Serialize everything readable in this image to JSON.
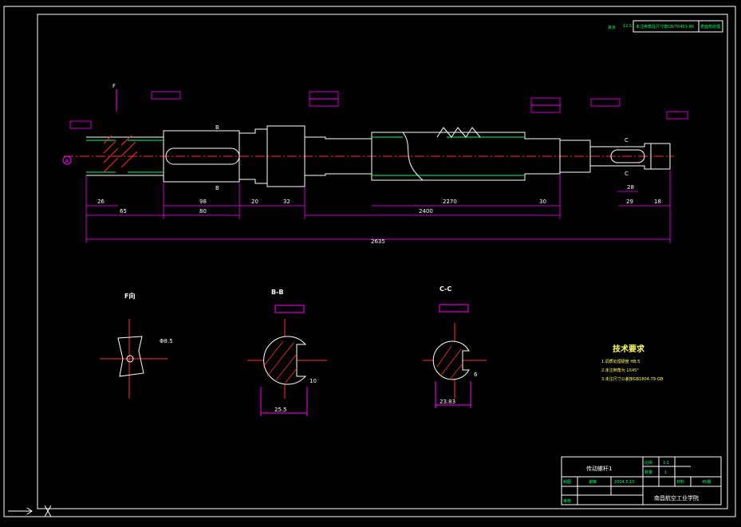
{
  "drawing": {
    "top_left_note": "F向",
    "corner_note": "其余",
    "corner_roughness": "12.5",
    "stamp_text": "未注倒角及尺寸按GB/T6403-86",
    "stamp_text2": "表面热处理"
  },
  "main_view": {
    "dims_bottom_row1": [
      "26",
      "98",
      "20",
      "32",
      "2270",
      "30",
      "29",
      "18"
    ],
    "dims_bottom_row2": [
      "65",
      "80",
      "2400"
    ],
    "dim_total": "2635",
    "dim_right_keyway": "28",
    "section_mark_b": "B",
    "section_mark_c": "C",
    "arrow_a": "A",
    "label_f": "F"
  },
  "sections": {
    "f_view": {
      "title": "F向",
      "dim": "Φ8.5"
    },
    "b_b": {
      "title": "B-B",
      "width": "25.5",
      "depth": "10"
    },
    "c_c": {
      "title": "C-C",
      "width": "23.83",
      "depth": "6"
    }
  },
  "tech_req": {
    "title": "技术要求",
    "items": [
      "1.调质处理硬度 HB:5",
      "2.未注倒角为 1X45°",
      "3.未注尺寸公差按GB1804-79-GB"
    ]
  },
  "title_block": {
    "part_name": "传动螺杆1",
    "label_scale": "比例",
    "scale": "1:1",
    "label_count": "数量",
    "count": "1",
    "label_draw": "制图",
    "drawer": "谢锋",
    "date": "2004.5.15",
    "label_material": "材料",
    "material": "45钢",
    "label_check": "审核",
    "school": "南昌航空工业学院"
  }
}
